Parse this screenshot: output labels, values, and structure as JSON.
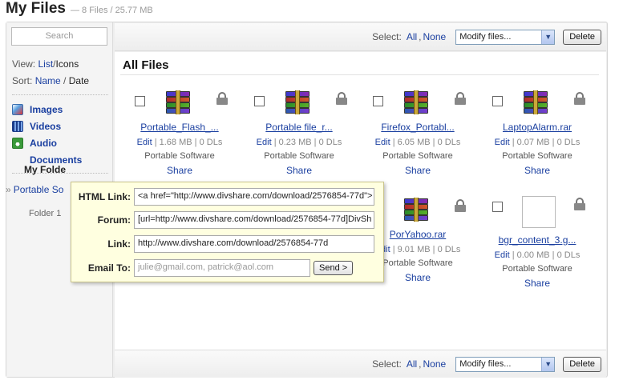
{
  "header": {
    "title": "My Files",
    "subtitle": "— 8 Files / 25.77 MB"
  },
  "sidebar": {
    "search_placeholder": "Search",
    "view_label": "View:",
    "view_list": "List",
    "view_separator": "/",
    "view_icons": "Icons",
    "sort_label": "Sort:",
    "sort_name": "Name",
    "sort_separator": "/",
    "sort_date": "Date",
    "categories": [
      {
        "label": "Images",
        "icon": "images-icon"
      },
      {
        "label": "Videos",
        "icon": "videos-icon"
      },
      {
        "label": "Audio",
        "icon": "audio-icon"
      },
      {
        "label": "Documents",
        "icon": ""
      }
    ],
    "folders_heading": "My Folde",
    "folder_arrow": "»",
    "folder_active": "Portable So",
    "folder_sub": "Folder 1"
  },
  "toolbar": {
    "select_label": "Select:",
    "select_all": "All",
    "select_separator": ",",
    "select_none": "None",
    "modify_value": "Modify files...",
    "delete_label": "Delete"
  },
  "main": {
    "heading": "All Files",
    "files": [
      {
        "name": "Portable_Flash_...",
        "edit": "Edit",
        "size": "1.68 MB",
        "dls": "0 DLs",
        "category": "Portable Software",
        "share": "Share",
        "icon": "rar-icon"
      },
      {
        "name": "Portable file_r...",
        "edit": "Edit",
        "size": "0.23 MB",
        "dls": "0 DLs",
        "category": "Portable Software",
        "share": "Share",
        "icon": "rar-icon"
      },
      {
        "name": "Firefox_Portabl...",
        "edit": "Edit",
        "size": "6.05 MB",
        "dls": "0 DLs",
        "category": "Portable Software",
        "share": "Share",
        "icon": "rar-icon"
      },
      {
        "name": "LaptopAlarm.rar",
        "edit": "Edit",
        "size": "0.07 MB",
        "dls": "0 DLs",
        "category": "Portable Software",
        "share": "Share",
        "icon": "rar-icon"
      },
      {
        "name": "PorYahoo.rar",
        "edit": "Edit",
        "size": "9.01 MB",
        "dls": "0 DLs",
        "category": "Portable Software",
        "share": "Share",
        "icon": "rar-icon"
      },
      {
        "name": "bgr_content_3.g...",
        "edit": "Edit",
        "size": "0.00 MB",
        "dls": "0 DLs",
        "category": "Portable Software",
        "share": "Share",
        "icon": "blank-thumbnail"
      }
    ]
  },
  "share_popup": {
    "html_label": "HTML Link:",
    "html_value": "<a href=\"http://www.divshare.com/download/2576854-77d\">",
    "forum_label": "Forum:",
    "forum_value": "[url=http://www.divshare.com/download/2576854-77d]DivSh",
    "link_label": "Link:",
    "link_value": "http://www.divshare.com/download/2576854-77d",
    "email_label": "Email To:",
    "email_placeholder": "julie@gmail.com, patrick@aol.com",
    "send_label": "Send >"
  }
}
